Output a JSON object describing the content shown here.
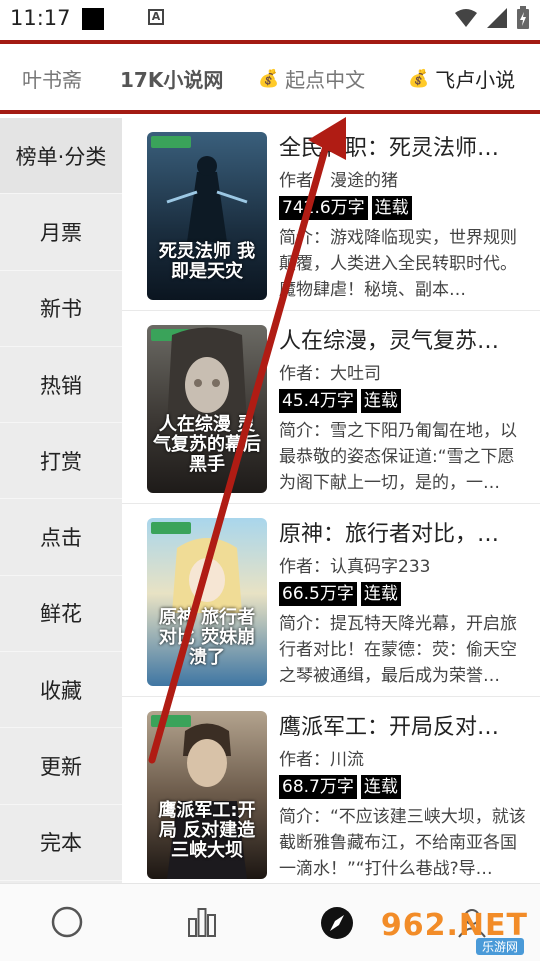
{
  "status": {
    "time": "11:17"
  },
  "tabs": [
    {
      "label": "叶书斋",
      "coin": false
    },
    {
      "label": "17K小说网",
      "coin": false
    },
    {
      "label": "起点中文",
      "coin": true
    },
    {
      "label": "飞卢小说",
      "coin": true
    }
  ],
  "sidebar": [
    "榜单·分类",
    "月票",
    "新书",
    "热销",
    "打赏",
    "点击",
    "鲜花",
    "收藏",
    "更新",
    "完本"
  ],
  "books": [
    {
      "title": "全民转职：死灵法师…",
      "author": "作者：漫途的猪",
      "words": "742.6万字",
      "status": "连载",
      "desc": "简介：游戏降临现实，世界规则颠覆，人类进入全民转职时代。魔物肆虐！秘境、副本…",
      "cover_title": "死灵法师 我即是天灾",
      "cover_colors": [
        "#2b4a63",
        "#0f1e2c"
      ]
    },
    {
      "title": "人在综漫，灵气复苏…",
      "author": "作者：大吐司",
      "words": "45.4万字",
      "status": "连载",
      "desc": "简介：雪之下阳乃匍匐在地，以最恭敬的姿态保证道:“雪之下愿为阁下献上一切，是的，一…",
      "cover_title": "人在综漫 灵气复苏的幕后黑手",
      "cover_colors": [
        "#5b5a55",
        "#2a2724"
      ]
    },
    {
      "title": "原神：旅行者对比，…",
      "author": "作者：认真码字233",
      "words": "66.5万字",
      "status": "连载",
      "desc": "简介：提瓦特天降光幕，开启旅行者对比！在蒙德：荧：偷天空之琴被通缉，最后成为荣誉…",
      "cover_title": "原神 旅行者对比 荧妹崩溃了",
      "cover_colors": [
        "#8fc6e2",
        "#3c6f9a"
      ]
    },
    {
      "title": "鹰派军工：开局反对…",
      "author": "作者：川流",
      "words": "68.7万字",
      "status": "连载",
      "desc": "简介：“不应该建三峡大坝，就该截断雅鲁藏布江，不给南亚各国一滴水！”“打什么巷战?导…",
      "cover_title": "鹰派军工:开局 反对建造三峡大坝",
      "cover_colors": [
        "#8a7a68",
        "#2e2620"
      ]
    }
  ],
  "bottom_nav": [
    "circle-icon",
    "bars-icon",
    "compass-icon",
    "user-icon"
  ],
  "watermark": {
    "brand": "962.NET",
    "sub": "乐游网"
  },
  "colors": {
    "accent": "#a31a12",
    "arrow": "#b01c14"
  }
}
